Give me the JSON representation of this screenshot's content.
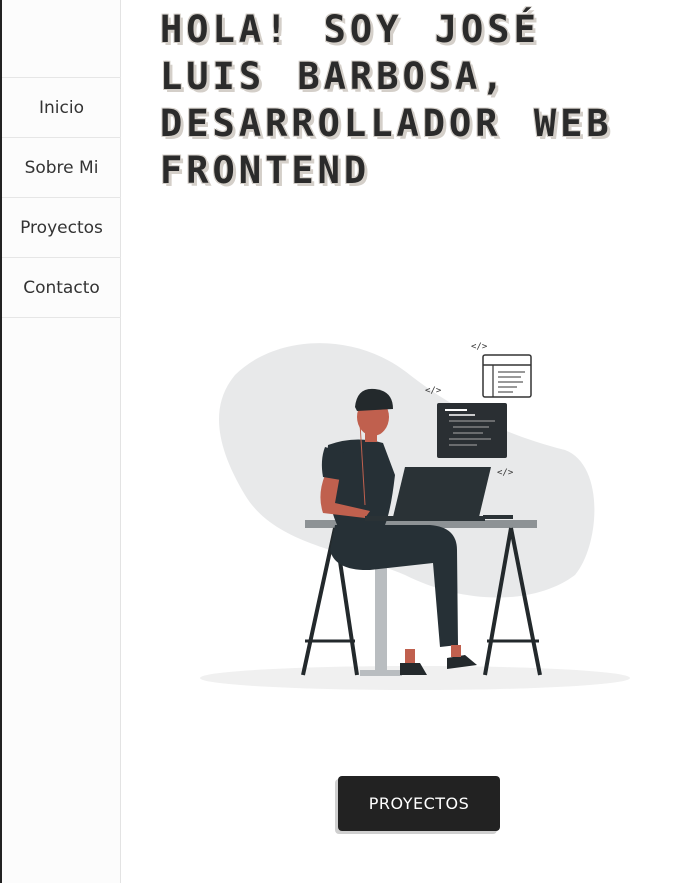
{
  "nav": {
    "items": [
      {
        "label": "Inicio"
      },
      {
        "label": "Sobre Mi"
      },
      {
        "label": "Proyectos"
      },
      {
        "label": "Contacto"
      }
    ]
  },
  "hero": {
    "headline": "HOLA! SOY JOSÉ LUIS BARBOSA, DESARROLLADOR WEB FRONTEND",
    "illustration_icon": "developer-at-desk-illustration",
    "cta_label": "PROYECTOS"
  },
  "code_tag": "</>",
  "colors": {
    "text": "#2b2b2b",
    "headline_shadow": "#d4cfc9",
    "button_bg": "#222222",
    "skin": "#c0604e",
    "blob": "#e8e9ea"
  }
}
